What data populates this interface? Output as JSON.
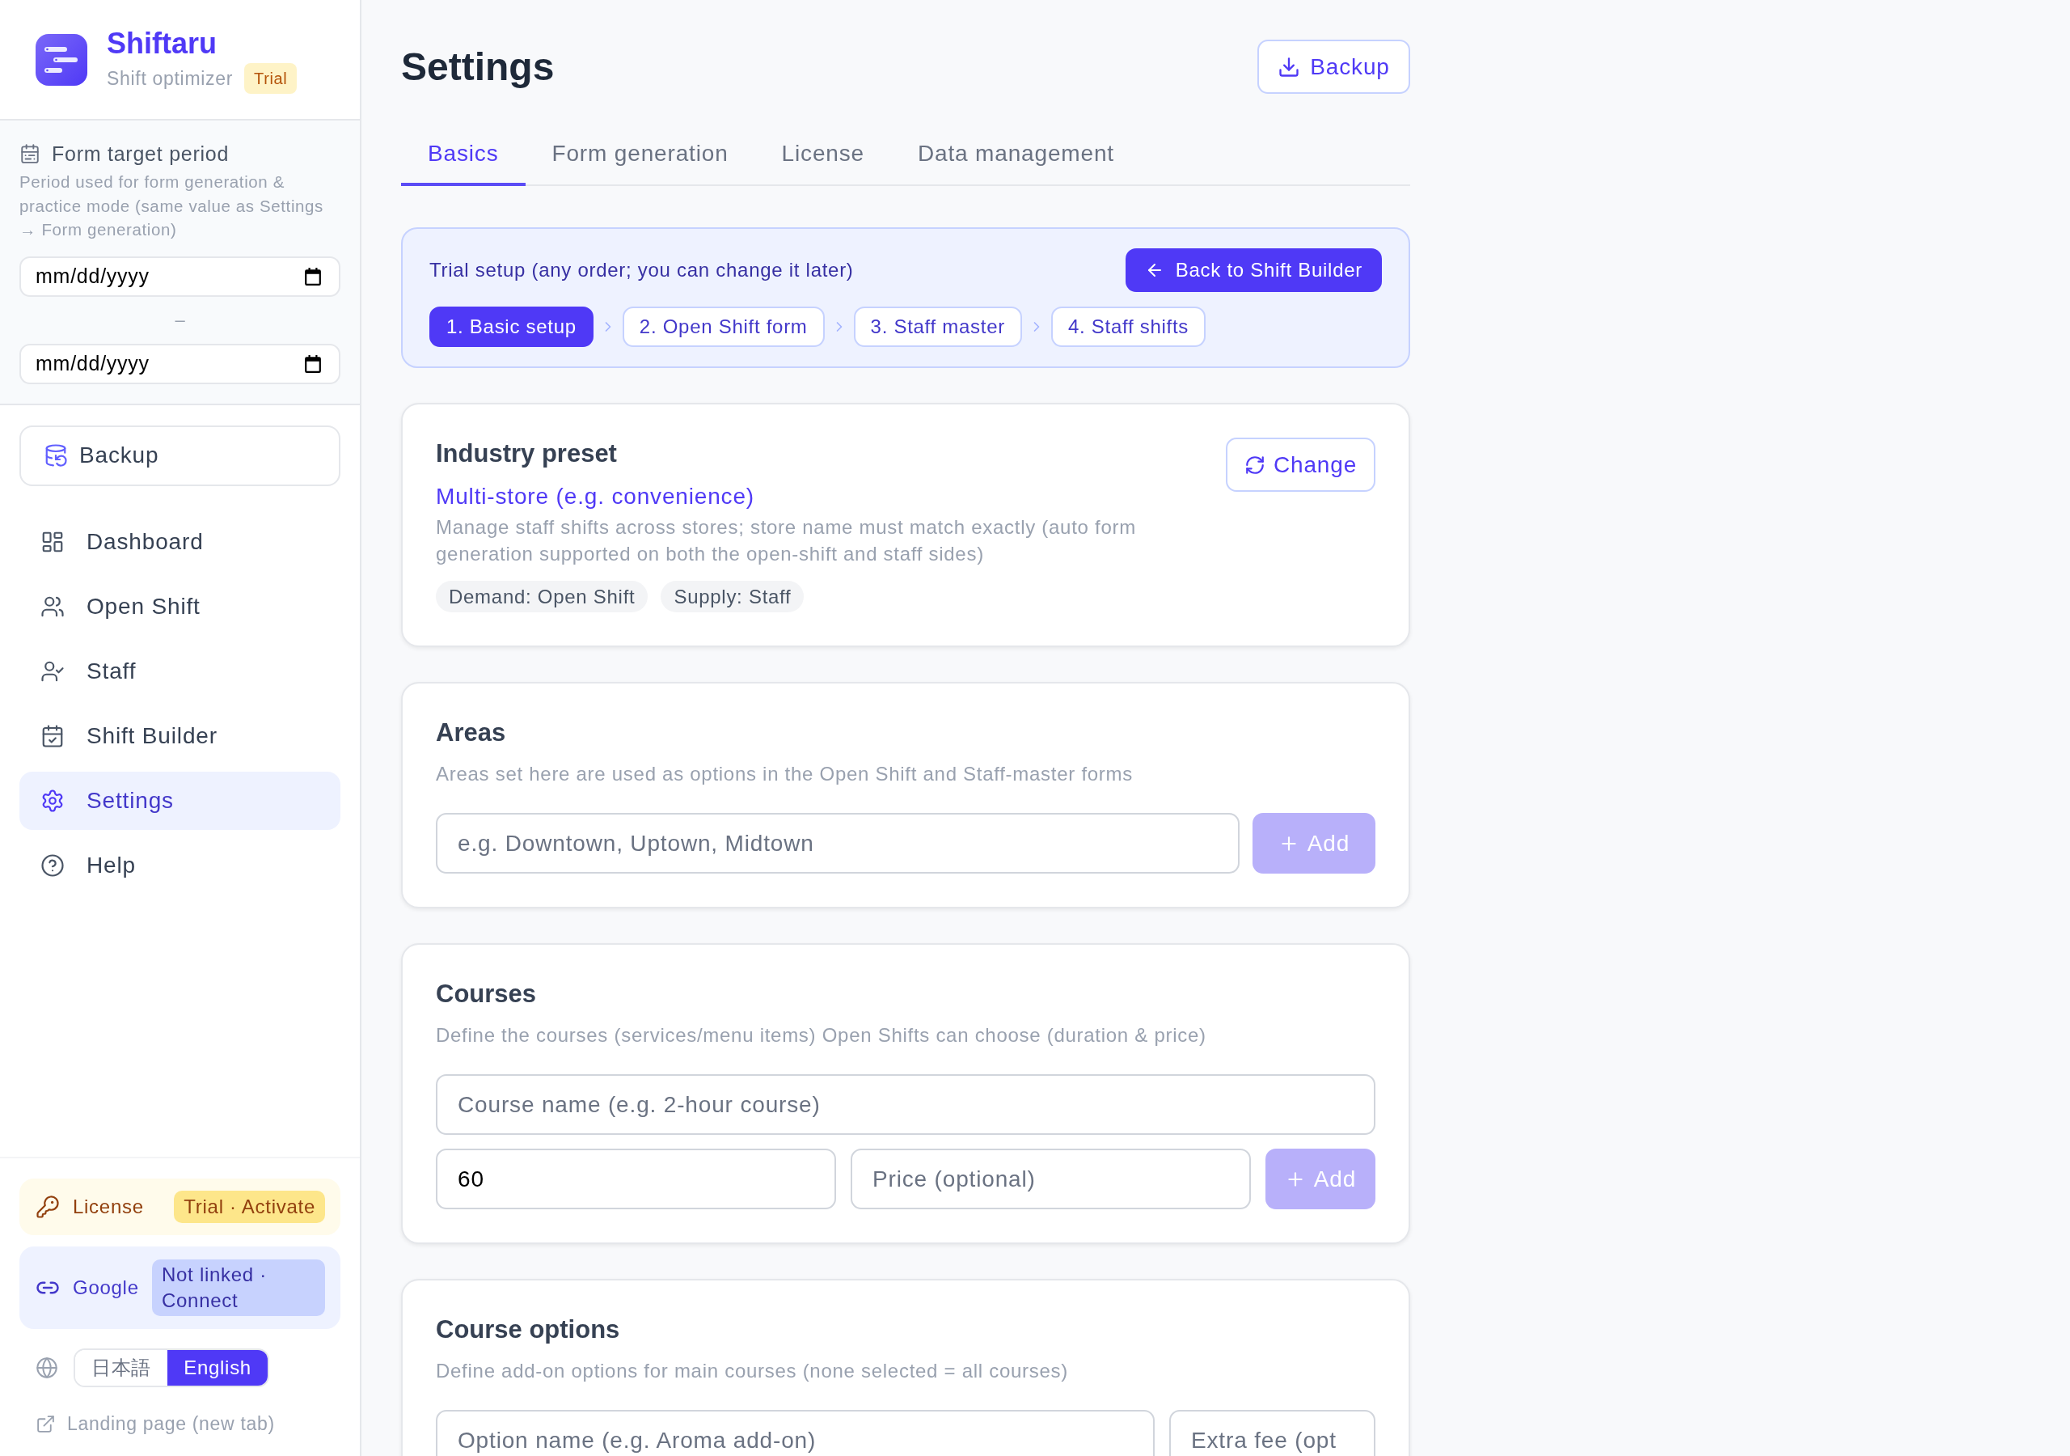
{
  "sidebar": {
    "brand": {
      "name": "Shiftaru",
      "subtitle": "Shift optimizer",
      "badge": "Trial"
    },
    "period": {
      "title": "Form target period",
      "description": "Period used for form generation & practice mode (same value as Settings → Form generation)",
      "start": {
        "placeholder": "mm/dd/yyyy"
      },
      "separator": "–",
      "end": {
        "placeholder": "mm/dd/yyyy"
      }
    },
    "backup_button": "Backup",
    "nav": [
      {
        "label": "Dashboard",
        "selected": false
      },
      {
        "label": "Open Shift",
        "selected": false
      },
      {
        "label": "Staff",
        "selected": false
      },
      {
        "label": "Shift Builder",
        "selected": false
      },
      {
        "label": "Settings",
        "selected": true
      },
      {
        "label": "Help",
        "selected": false
      }
    ],
    "license": {
      "label": "License",
      "badge": "Trial · Activate"
    },
    "google": {
      "label": "Google",
      "badge": "Not linked · Connect"
    },
    "language": [
      {
        "label": "日本語",
        "selected": false
      },
      {
        "label": "English",
        "selected": true
      }
    ],
    "landing_link": "Landing page (new tab)"
  },
  "header": {
    "title": "Settings",
    "backup_button": "Backup"
  },
  "tabs": [
    {
      "label": "Basics",
      "selected": true
    },
    {
      "label": "Form generation",
      "selected": false
    },
    {
      "label": "License",
      "selected": false
    },
    {
      "label": "Data management",
      "selected": false
    }
  ],
  "trial_setup": {
    "text": "Trial setup (any order; you can change it later)",
    "back_button": "Back to Shift Builder",
    "steps": [
      {
        "label": "1. Basic setup",
        "selected": true
      },
      {
        "label": "2. Open Shift form",
        "selected": false
      },
      {
        "label": "3. Staff master",
        "selected": false
      },
      {
        "label": "4. Staff shifts",
        "selected": false
      }
    ]
  },
  "industry_preset": {
    "title": "Industry preset",
    "preset_name": "Multi-store (e.g. convenience)",
    "description": "Manage staff shifts across stores; store name must match exactly (auto form generation supported on both the open-shift and staff sides)",
    "tags": [
      "Demand: Open Shift",
      "Supply: Staff"
    ],
    "change_button": "Change"
  },
  "areas": {
    "title": "Areas",
    "description": "Areas set here are used as options in the Open Shift and Staff-master forms",
    "input": {
      "placeholder": "e.g. Downtown, Uptown, Midtown"
    },
    "add_button": {
      "label": "Add",
      "disabled": true
    }
  },
  "courses": {
    "title": "Courses",
    "description": "Define the courses (services/menu items) Open Shifts can choose (duration & price)",
    "name_input": {
      "placeholder": "Course name (e.g. 2-hour course)"
    },
    "duration_input": {
      "value": "60"
    },
    "price_input": {
      "placeholder": "Price (optional)"
    },
    "add_button": {
      "label": "Add",
      "disabled": true
    }
  },
  "course_options": {
    "title": "Course options",
    "description": "Define add-on options for main courses (none selected = all courses)",
    "name_input": {
      "placeholder": "Option name (e.g. Aroma add-on)"
    },
    "fee_input": {
      "placeholder": "Extra fee (opt"
    }
  }
}
